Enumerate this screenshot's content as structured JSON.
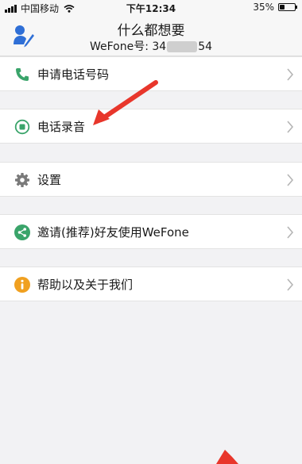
{
  "status_bar": {
    "carrier": "中国移动",
    "time": "下午12:34",
    "battery": "35%",
    "battery_level": 0.35
  },
  "header": {
    "title": "什么都想要",
    "id_prefix": "WeFone号: 34",
    "id_suffix": "54"
  },
  "menu": [
    {
      "label": "申请电话号码",
      "icon": "phone-icon",
      "color": "#3aa46a"
    },
    {
      "label": "电话录音",
      "icon": "record-icon",
      "color": "#3aa46a"
    },
    {
      "label": "设置",
      "icon": "gear-icon",
      "color": "#7a7a7a"
    },
    {
      "label": "邀请(推荐)好友使用WeFone",
      "icon": "share-icon",
      "color": "#3aa46a"
    },
    {
      "label": "帮助以及关于我们",
      "icon": "info-icon",
      "color": "#f0a020"
    }
  ],
  "colors": {
    "accent_green": "#3aa46a",
    "profile_blue": "#2f6fd6",
    "annotation_red": "#e8362b",
    "background": "#f2f2f4"
  }
}
